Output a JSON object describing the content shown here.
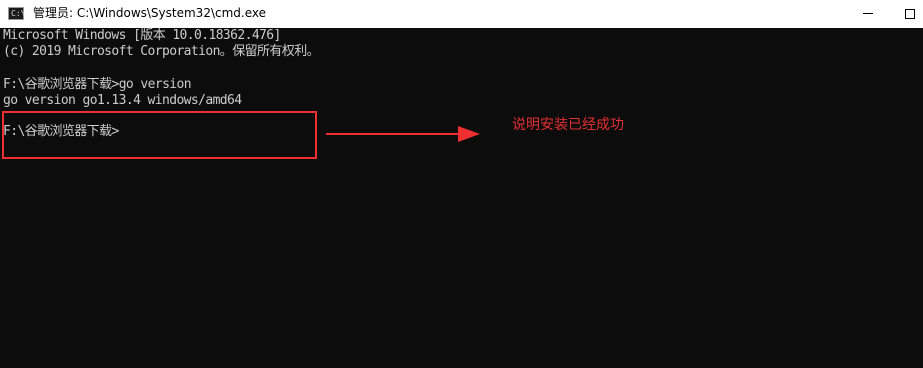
{
  "window": {
    "title": "管理员: C:\\Windows\\System32\\cmd.exe",
    "icon": "cmd-icon",
    "controls": [
      "minimize-icon",
      "maximize-icon"
    ]
  },
  "console": {
    "lines": [
      "Microsoft Windows [版本 10.0.18362.476]",
      "(c) 2019 Microsoft Corporation。保留所有权利。",
      "F:\\谷歌浏览器下载>go version",
      "go version go1.13.4 windows/amd64",
      "F:\\谷歌浏览器下载>"
    ]
  },
  "annotation": {
    "text": "说明安装已经成功",
    "color": "#e33030"
  },
  "colors": {
    "background": "#0c0c0c",
    "text": "#cccccc",
    "highlight": "#f03030"
  }
}
